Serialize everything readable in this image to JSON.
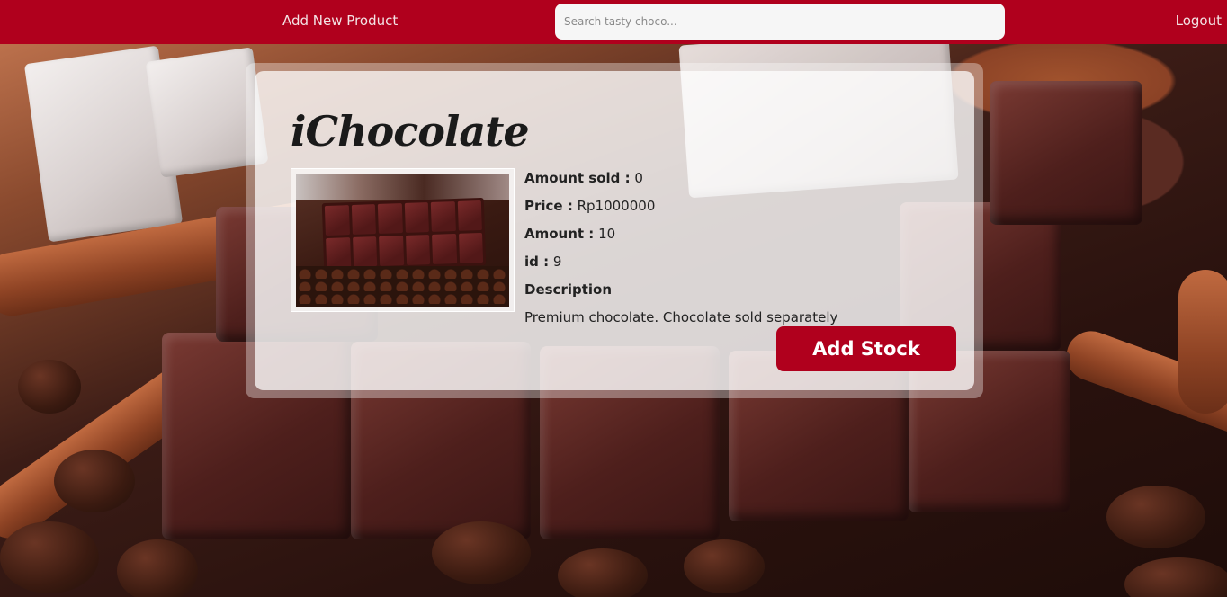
{
  "navbar": {
    "add_product_label": "Add New Product",
    "search_placeholder": "Search tasty choco...",
    "logout_label": "Logout"
  },
  "product": {
    "title": "iChocolate",
    "fields": {
      "amount_sold_label": "Amount sold :",
      "amount_sold_value": "0",
      "price_label": "Price :",
      "price_value": "Rp1000000",
      "amount_label": "Amount :",
      "amount_value": "10",
      "id_label": "id :",
      "id_value": "9",
      "description_label": "Description",
      "description_value": "Premium chocolate. Chocolate sold separately"
    },
    "add_stock_label": "Add Stock"
  },
  "colors": {
    "brand": "#b0001d",
    "card_bg": "rgba(255,255,255,0.72)"
  }
}
